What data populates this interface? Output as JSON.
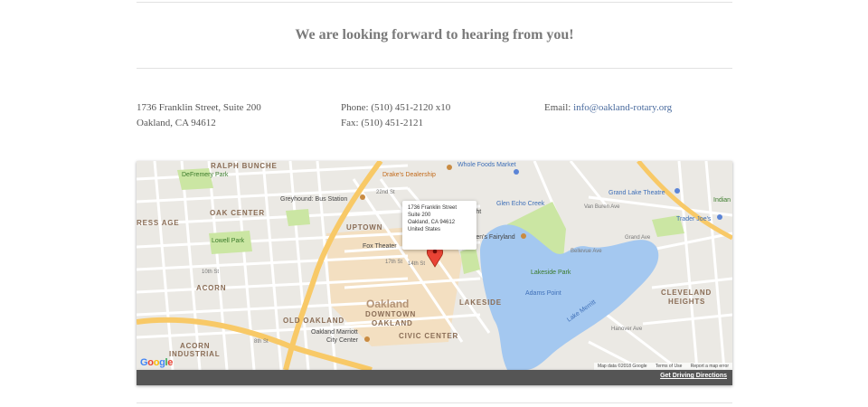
{
  "headline": "We are looking forward to hearing from you!",
  "contact": {
    "address_line1": "1736 Franklin Street, Suite 200",
    "address_line2": "Oakland, CA 94612",
    "phone_label": "Phone:",
    "phone": "(510) 451-2120 x10",
    "fax_label": "Fax:",
    "fax": "(510) 451-2121",
    "email_label": "Email:",
    "email": "info@oakland-rotary.org"
  },
  "map": {
    "info_window": [
      "1736 Franklin Street",
      "Suite 200",
      "Oakland, CA 94612",
      "United States"
    ],
    "labels": {
      "ralph_bunche": "RALPH BUNCHE",
      "defremery_park": "DeFremery Park",
      "drakes_dealership": "Drake's Dealership",
      "whole_foods": "Whole Foods Market",
      "grand_lake_theatre": "Grand Lake Theatre",
      "indian": "Indian",
      "trader_joes": "Trader Joe's",
      "oak_center": "OAK CENTER",
      "greyhound": "Greyhound: Bus Station",
      "uptown": "UPTOWN",
      "light": "Light",
      "glen_echo_creek": "Glen Echo Creek",
      "childrens_fairyland": "ildren's Fairyland",
      "ress_age": "RESS AGE",
      "lowell_park": "Lowell Park",
      "fox_theater": "Fox Theater",
      "lakeside_park": "Lakeside Park",
      "acorn": "ACORN",
      "oakland": "Oakland",
      "adams_point": "Adams Point",
      "cleveland": "CLEVELAND",
      "heights": "HEIGHTS",
      "lakeside": "LAKESIDE",
      "lake_merritt": "Lake Merritt",
      "old_oakland": "OLD OAKLAND",
      "downtown": "DOWNTOWN",
      "downtown_oakland": "OAKLAND",
      "marriott": "Oakland Marriott",
      "marriott_2": "City Center",
      "civic_center": "CIVIC CENTER",
      "acorn_industrial_1": "ACORN",
      "acorn_industrial_2": "INDUSTRIAL",
      "street_22nd": "22nd St",
      "street_17th": "17th St",
      "street_14th": "14th St",
      "street_10th": "10th St",
      "street_8th": "8th St",
      "hanover": "Hanover Ave",
      "bellevue": "Bellevue Ave",
      "van_buren": "Van Buren Ave",
      "grand_ave": "Grand Ave"
    },
    "google_logo": "Google",
    "attribution": "Map data ©2018 Google",
    "terms": "Terms of Use",
    "report": "Report a map error"
  },
  "driving_link": "Get Driving Directions",
  "colors": {
    "water": "#a4c8f0",
    "park": "#cbe6a3",
    "highway": "#f8c967",
    "road": "#ffffff",
    "downtown": "#f3dfc1",
    "link": "#4a6b9e",
    "pin": "#ea4335"
  }
}
